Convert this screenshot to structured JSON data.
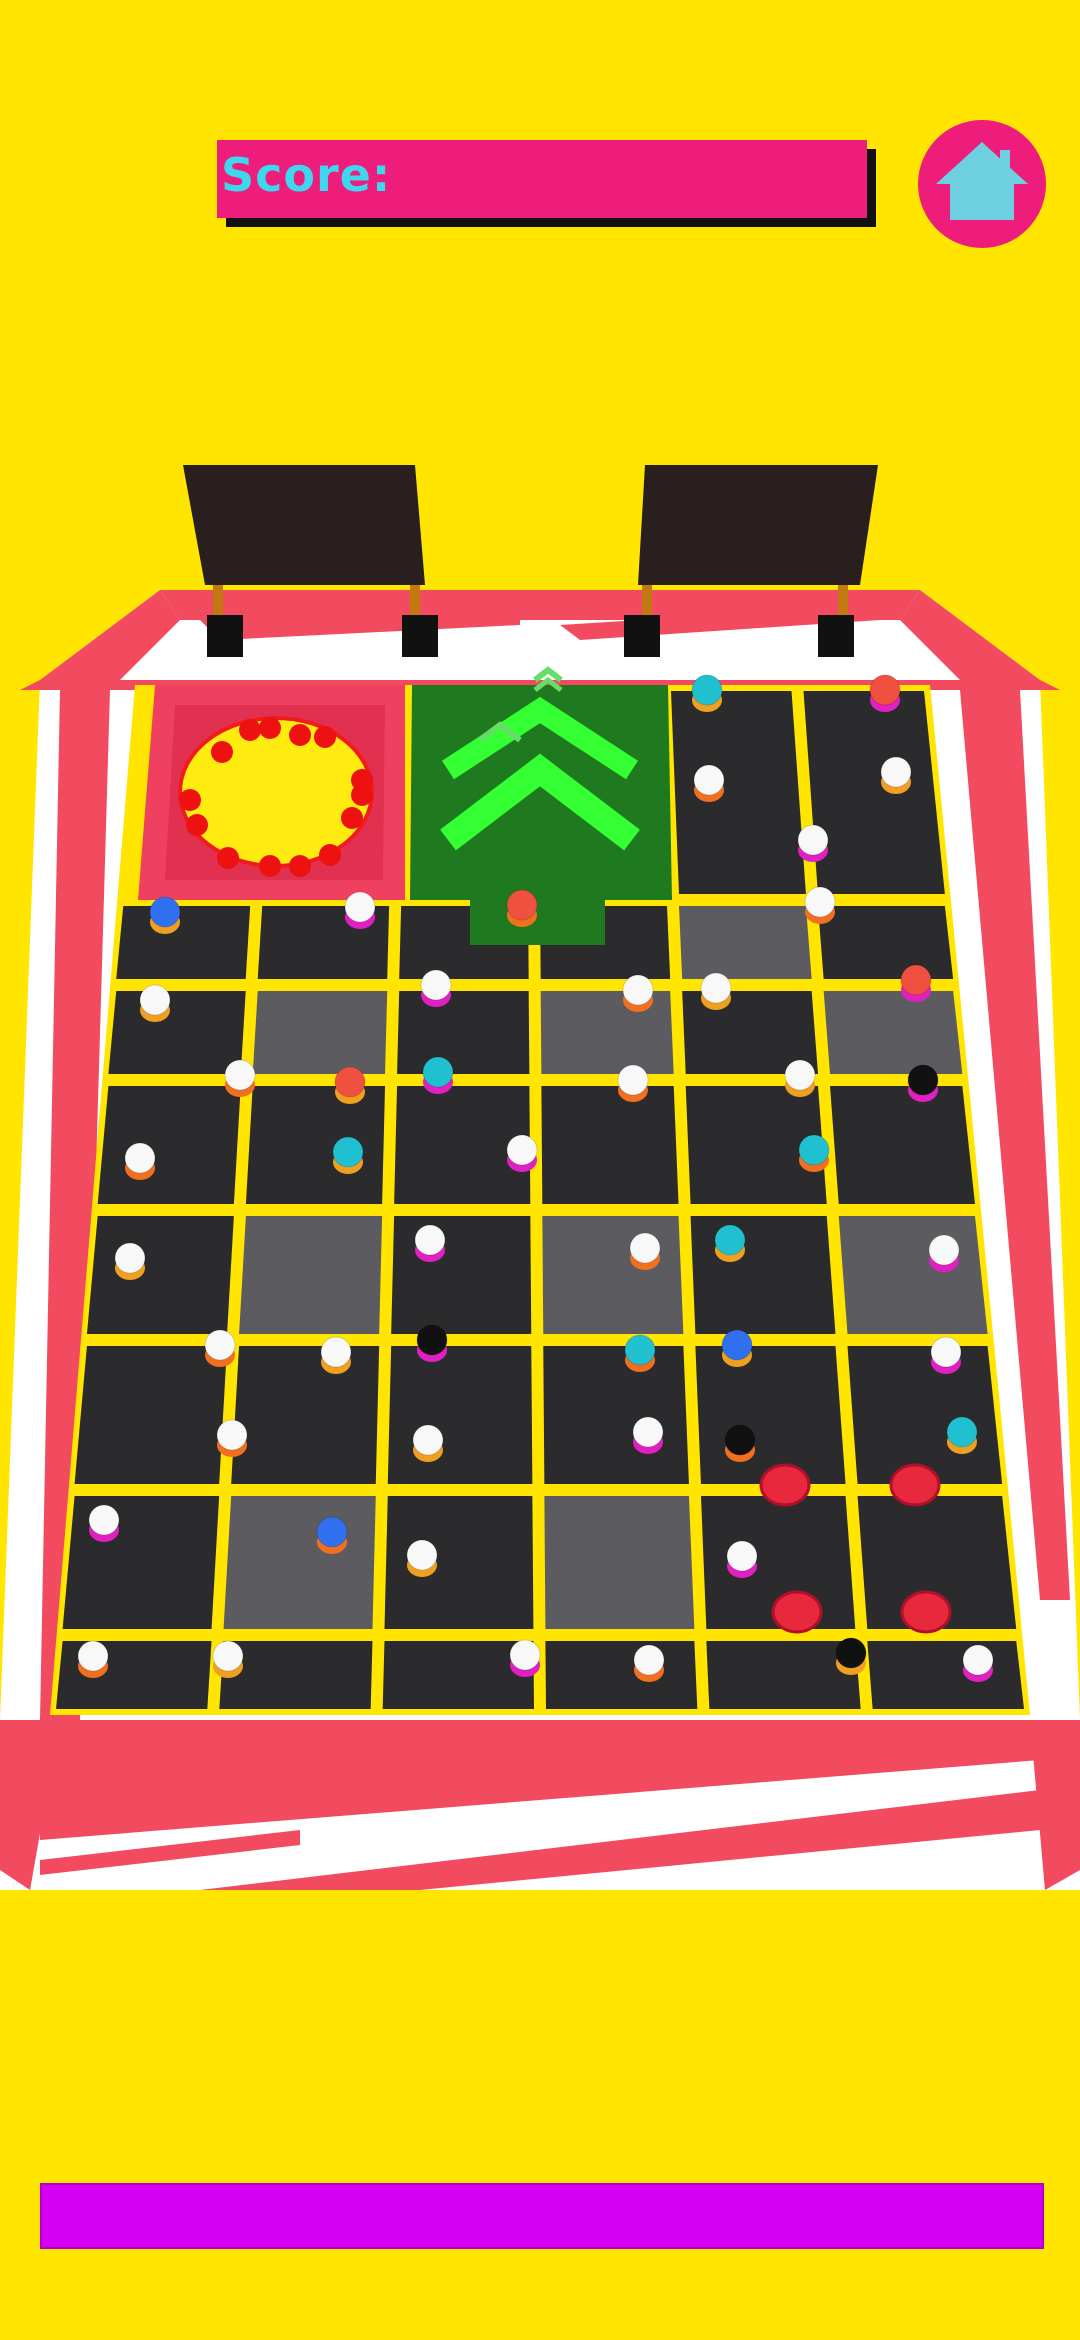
{
  "hud": {
    "score_label": "Score:",
    "score_value": "",
    "home_icon": "home-icon"
  },
  "colors": {
    "background": "#FFE500",
    "score_bar": "#EE1C7A",
    "home_button": "#EE1C7A",
    "home_icon": "#6DCFE0",
    "progress_bar": "#D600F5",
    "tile_dark": "#2B2B2E",
    "tile_light": "#5C5C60",
    "goal_pad": "#F04060",
    "boost_pad": "#1F7A1F",
    "arrow": "#33FF33",
    "stripe_red": "#F24A5F"
  },
  "board": {
    "goal_hole_label": "",
    "boost_arrows": "chevron-up-icon",
    "bumper": "red-bumper"
  }
}
